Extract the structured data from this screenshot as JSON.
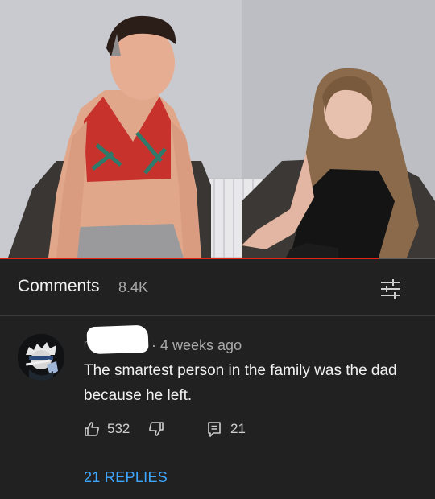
{
  "colors": {
    "background": "#212121",
    "text_primary": "#f1f1f1",
    "text_secondary": "#aaaaaa",
    "link": "#3ea6ff",
    "progress": "#e62117"
  },
  "video": {
    "progress_fraction": 0.87
  },
  "comments_header": {
    "title": "Comments",
    "count": "8.4K",
    "sort_icon": "sort-sliders-icon"
  },
  "comment": {
    "username_initial": "r",
    "separator": "·",
    "timestamp": "4 weeks ago",
    "text": "The smartest person in the family was the dad because he left.",
    "likes": "532",
    "replies_count": "21",
    "icons": {
      "like": "thumbs-up-icon",
      "dislike": "thumbs-down-icon",
      "reply": "reply-comment-icon"
    }
  },
  "replies_link": "21 REPLIES"
}
